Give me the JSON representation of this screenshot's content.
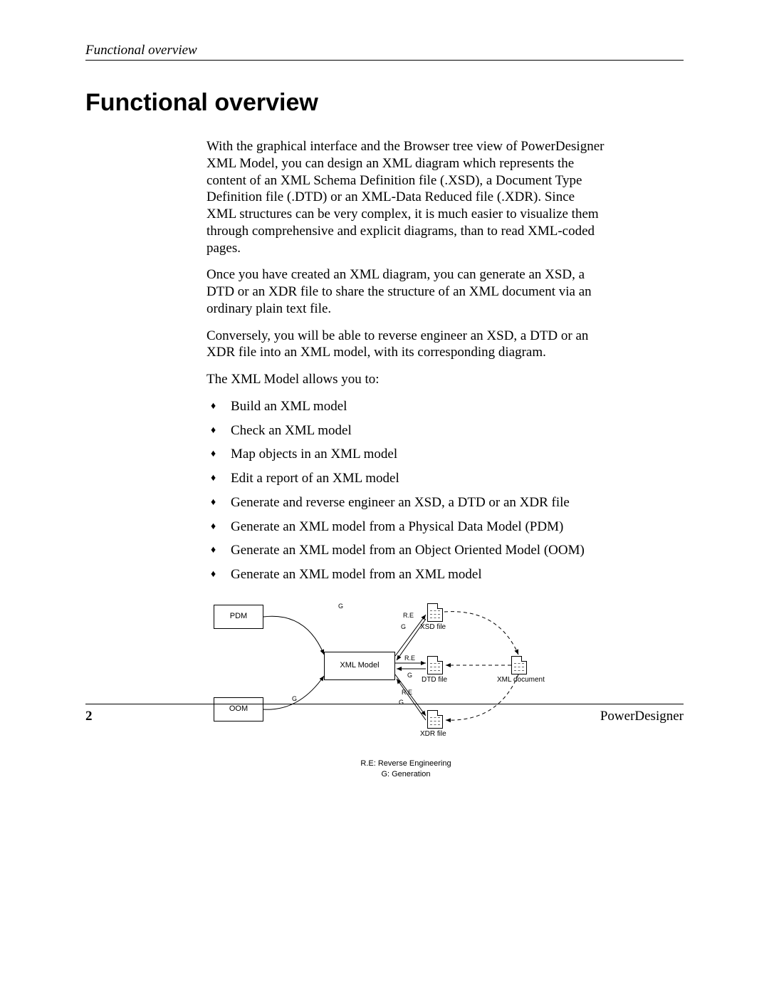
{
  "header": {
    "running": "Functional overview"
  },
  "title": "Functional overview",
  "paras": [
    "With the graphical interface and the Browser tree view of PowerDesigner XML Model, you can design an XML diagram which represents the content of an XML Schema Definition file (.XSD), a Document Type Definition file (.DTD) or an XML-Data Reduced file (.XDR). Since XML structures can be very complex, it is much easier to visualize them through comprehensive and explicit diagrams, than to read XML-coded pages.",
    "Once you have created an XML diagram, you can generate an XSD, a DTD or an XDR file to share the structure of an XML document via an ordinary plain text file.",
    "Conversely, you will be able to reverse engineer an XSD, a DTD or an XDR file into an XML model, with its corresponding diagram.",
    "The XML Model allows you to:"
  ],
  "bullets": [
    "Build an XML model",
    "Check an XML model",
    "Map objects in an XML model",
    "Edit a report of an XML model",
    "Generate and reverse engineer an XSD, a DTD or an XDR file",
    "Generate an XML model from a Physical Data Model (PDM)",
    "Generate an XML model from an Object Oriented Model (OOM)",
    "Generate an XML model from an XML model"
  ],
  "diagram": {
    "nodes": {
      "pdm": "PDM",
      "oom": "OOM",
      "center": "XML Model",
      "xsd": "XSD file",
      "dtd": "DTD file",
      "xdr": "XDR file",
      "xmldoc": "XML document"
    },
    "edge_labels": {
      "re": "R.E",
      "g": "G"
    },
    "legend": {
      "l1": "R.E: Reverse Engineering",
      "l2": "G: Generation"
    }
  },
  "footer": {
    "page": "2",
    "product": "PowerDesigner"
  }
}
